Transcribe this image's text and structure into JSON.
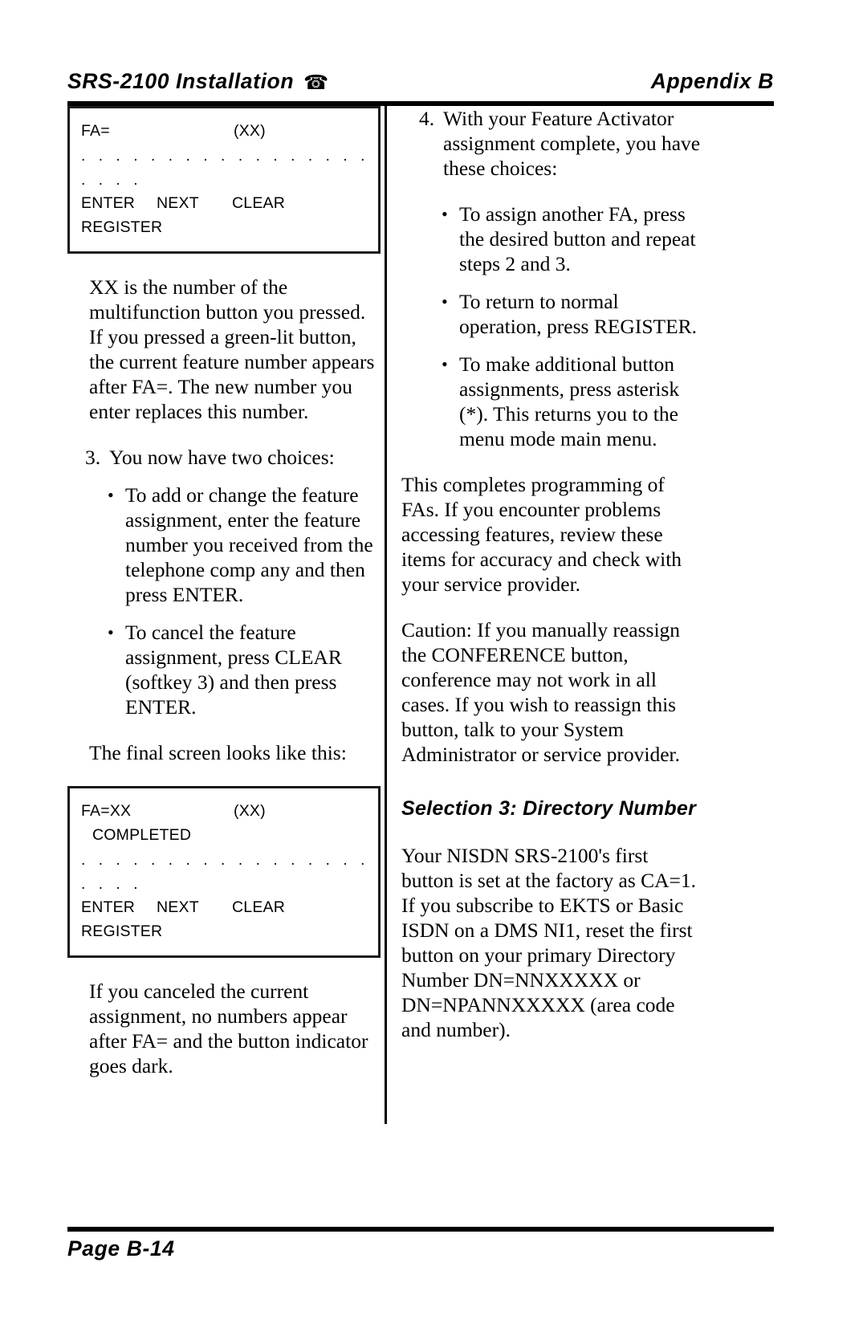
{
  "header": {
    "left_title": "SRS-2100 Installation",
    "phone_icon": "☎",
    "right_title": "Appendix B"
  },
  "footer": {
    "page_label": "Page B-14"
  },
  "left_column": {
    "screen_1": {
      "line1_label": "FA=",
      "line1_value": "(XX)",
      "line2_dots": ". . . . . . . . . . . . . . . . . . . . . . . . . . . . . .",
      "line3_dots": ". . . .",
      "softkey_1": "ENTER",
      "softkey_2": "NEXT",
      "softkey_3": "CLEAR",
      "softkey_4": "REGISTER"
    },
    "para_xx": "XX is the number of the multifunction button you pressed.  If you pressed a green-lit button, the current feature number appears after FA=.  The new number you enter replaces this number.",
    "step_3_num": "3.",
    "step_3_text": "You now have two choices:",
    "bullet_marker": "•",
    "step_3_bullets": [
      "To add or change the feature assignment, enter the feature number you received from the telephone comp any and then press ENTER.",
      "To cancel the feature assignment, press CLEAR (softkey 3) and then press ENTER."
    ],
    "final_screen_lead": "The final screen looks like this:",
    "screen_2": {
      "line1_label": "FA=XX",
      "line1_value": "(XX)",
      "line2_status": "COMPLETED",
      "line3_dots": ". . . . . . . . . . . . . . . . . . . . . . . . . . . . . .",
      "line4_dots": ". . . .",
      "softkey_1": "ENTER",
      "softkey_2": "NEXT",
      "softkey_3": "CLEAR",
      "softkey_4": "REGISTER"
    },
    "para_canceled": "If you canceled the current assignment, no numbers appear after FA= and the button indicator goes dark."
  },
  "right_column": {
    "step_4_num": "4.",
    "step_4_text": "With your Feature Activator assignment complete, you have these choices:",
    "bullet_marker": "•",
    "step_4_bullets": [
      "To assign another FA, press the desired button and repeat steps 2 and 3.",
      "To return to normal operation, press REGISTER.",
      "To make additional button assignments, press asterisk (*).  This returns you to the menu mode main menu."
    ],
    "para_completes": "This completes programming of FAs.  If you encounter problems accessing features, review these items for accuracy and check with your service provider.",
    "caution_label": "Caution:",
    "caution_text": "If you manually reassign the CONFERENCE button, conference may not work in all cases.  If you wish to reassign this button, talk to your System Administrator or service provider.",
    "section_heading": "Selection 3:  Directory Number",
    "para_dn": "Your NISDN SRS-2100's first button is set at the factory as CA=1.  If you subscribe to EKTS or Basic ISDN on a DMS NI1, reset the first button on your primary Directory Number DN=NNXXXXX or DN=NPANNXXXXX (area code and number)."
  }
}
